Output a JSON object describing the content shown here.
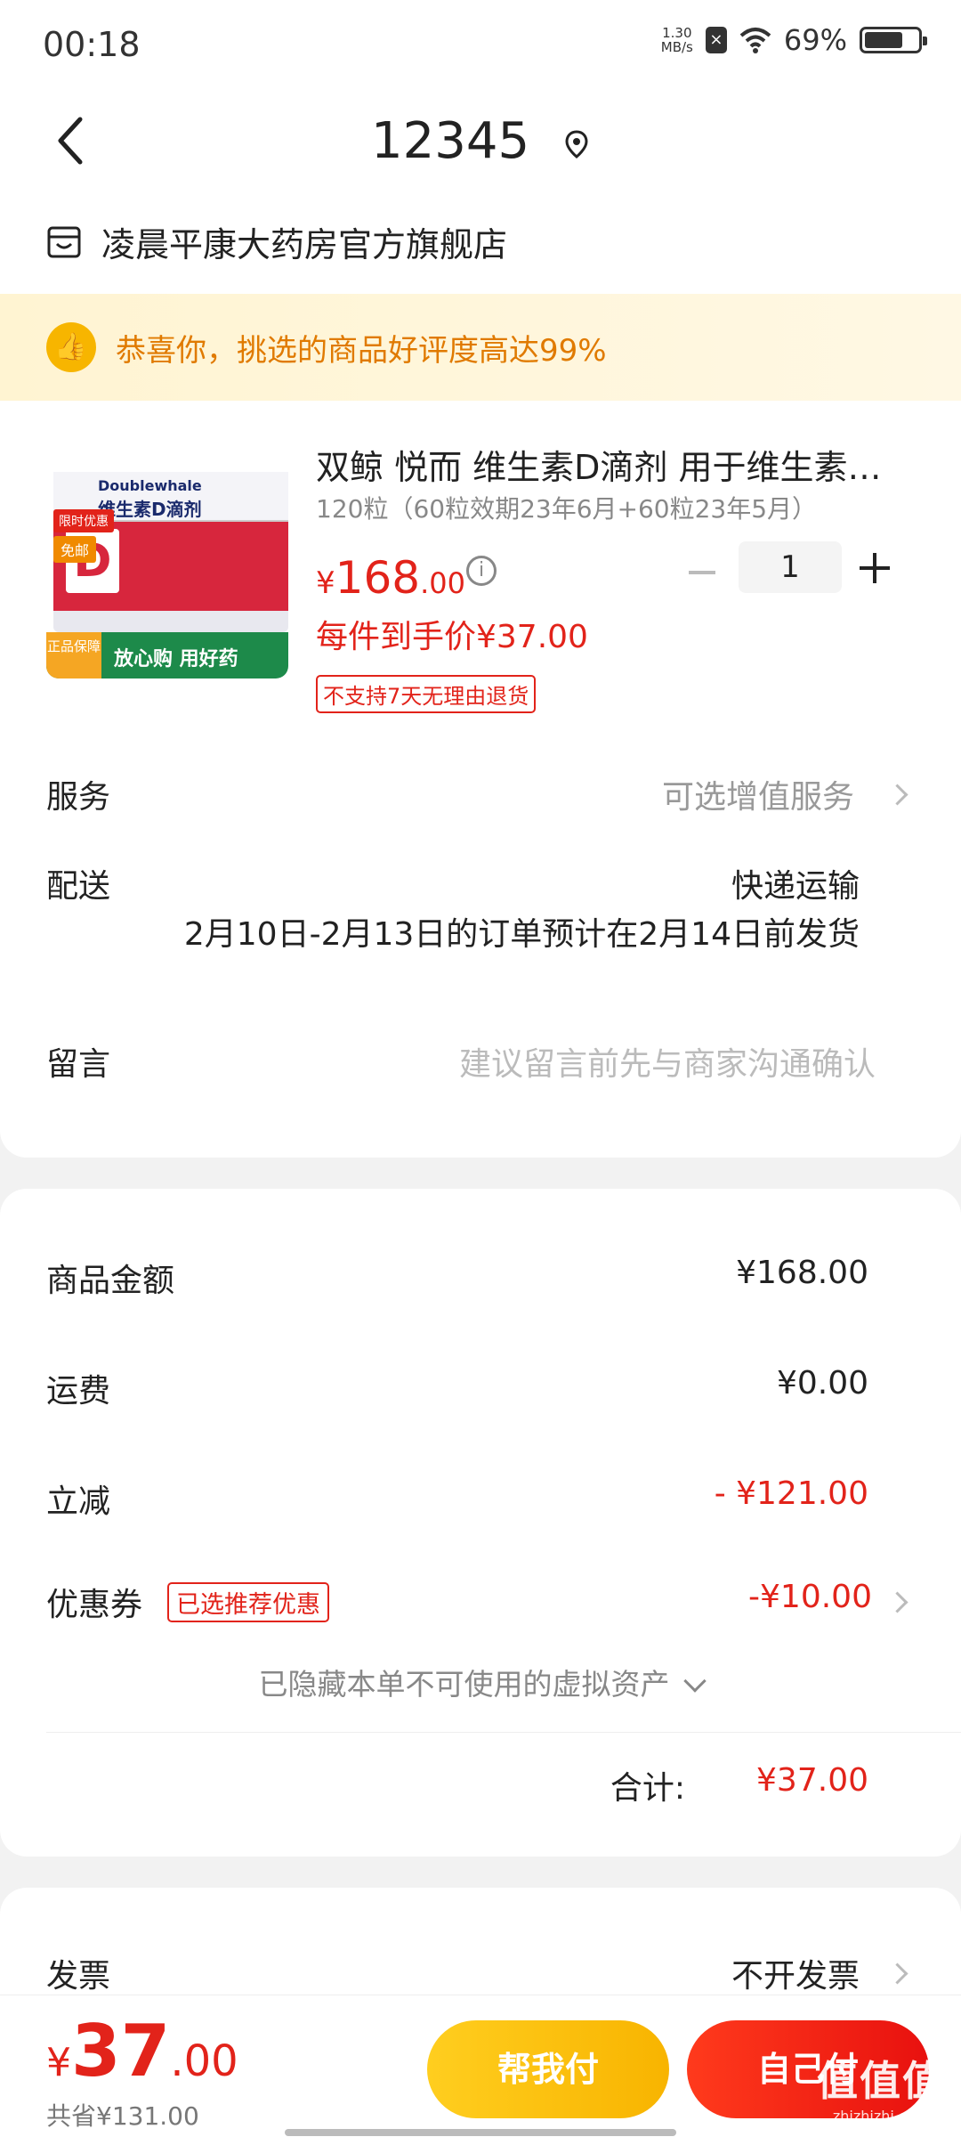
{
  "status_bar": {
    "time": "00:18",
    "net_speed_top": "1.30",
    "net_speed_bottom": "MB/s",
    "battery": "69%"
  },
  "header": {
    "title": "12345",
    "icons": [
      "back-arrow-icon",
      "location-pin-icon"
    ]
  },
  "shop": {
    "name": "凌晨平康大药房官方旗舰店",
    "icon": "store-icon"
  },
  "banner": {
    "text": "恭喜你，挑选的商品好评度高达99%",
    "icon": "thumbs-up-icon"
  },
  "product": {
    "title": "双鲸 悦而 维生素D滴剂 用于维生素…",
    "spec": "120粒（60粒效期23年6月+60粒23年5月）",
    "price_currency": "¥",
    "price_integer": "168",
    "price_decimal": ".00",
    "quantity": "1",
    "unit_price": "每件到手价¥37.00",
    "return_policy": "不支持7天无理由退货",
    "image": {
      "brand": "Doublewhale",
      "name": "维生素D滴剂",
      "d_letter": "D",
      "tag_limited": "限时优惠",
      "tag_free": "免邮",
      "footer_badge": "正品保障",
      "footer_text": "放心购 用好药"
    }
  },
  "rows": {
    "service_label": "服务",
    "service_value": "可选增值服务",
    "delivery_label": "配送",
    "delivery_method": "快递运输",
    "delivery_note": "2月10日-2月13日的订单预计在2月14日前发货",
    "message_label": "留言",
    "message_placeholder": "建议留言前先与商家沟通确认"
  },
  "summary": {
    "goods_label": "商品金额",
    "goods_value": "¥168.00",
    "shipping_label": "运费",
    "shipping_value": "¥0.00",
    "discount_label": "立减",
    "discount_value": "- ¥121.00",
    "coupon_label": "优惠券",
    "coupon_tag": "已选推荐优惠",
    "coupon_value": "-¥10.00",
    "hidden_assets": "已隐藏本单不可使用的虚拟资产",
    "total_label": "合计:",
    "total_value": "¥37.00"
  },
  "invoice": {
    "label": "发票",
    "value": "不开发票"
  },
  "bottom_bar": {
    "currency": "¥",
    "total_integer": "37",
    "total_decimal": ".00",
    "saved": "共省¥131.00",
    "help_pay": "帮我付",
    "self_pay": "自己付",
    "watermark_big": "值值值",
    "watermark_small": "zhizhizhi.com"
  },
  "colors": {
    "accent_red": "#e2231a",
    "banner_orange": "#e07a00",
    "help_button_yellow": "#ffce1f"
  }
}
